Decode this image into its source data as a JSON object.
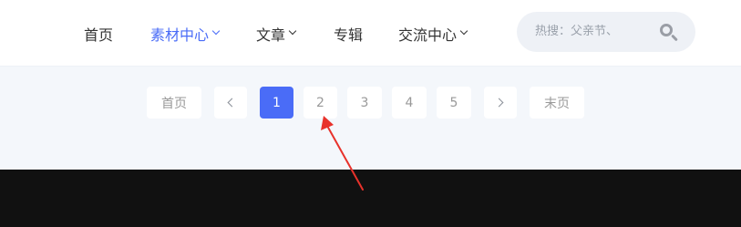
{
  "nav": {
    "items": [
      {
        "label": "首页",
        "has_dropdown": false,
        "active": false
      },
      {
        "label": "素材中心",
        "has_dropdown": true,
        "active": true
      },
      {
        "label": "文章",
        "has_dropdown": true,
        "active": false
      },
      {
        "label": "专辑",
        "has_dropdown": false,
        "active": false
      },
      {
        "label": "交流中心",
        "has_dropdown": true,
        "active": false
      }
    ],
    "active_color": "#4a6cf7"
  },
  "search": {
    "placeholder": "热搜：父亲节、",
    "icon": "search-icon"
  },
  "pagination": {
    "first_label": "首页",
    "last_label": "末页",
    "prev_icon": "chevron-left-icon",
    "next_icon": "chevron-right-icon",
    "pages": [
      "1",
      "2",
      "3",
      "4",
      "5"
    ],
    "current_page": "1",
    "current_color": "#4a6cf7"
  },
  "annotation": {
    "type": "red-arrow",
    "points_to": "2",
    "color": "#e8322b"
  }
}
